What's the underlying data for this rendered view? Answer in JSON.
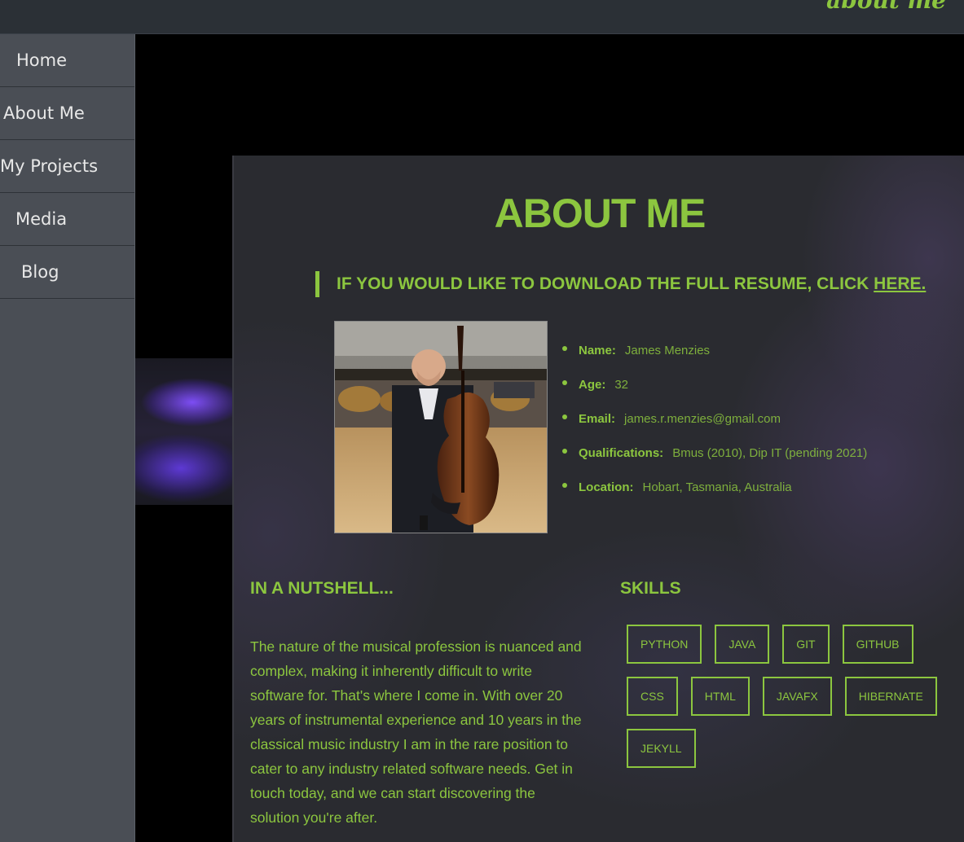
{
  "brand": "about me",
  "sidebar": {
    "items": [
      {
        "label": "Home"
      },
      {
        "label": "About Me"
      },
      {
        "label": "My Projects"
      },
      {
        "label": "Media"
      },
      {
        "label": "Blog"
      }
    ]
  },
  "main": {
    "title": "ABOUT ME",
    "resume_prefix": "IF YOU WOULD LIKE TO DOWNLOAD THE FULL RESUME, CLICK ",
    "resume_link": "HERE.",
    "info": [
      {
        "key": "Name:",
        "value": "James Menzies"
      },
      {
        "key": "Age:",
        "value": "32"
      },
      {
        "key": "Email:",
        "value": "james.r.menzies@gmail.com"
      },
      {
        "key": "Qualifications:",
        "value": "Bmus (2010), Dip IT (pending 2021)"
      },
      {
        "key": "Location:",
        "value": "Hobart, Tasmania, Australia"
      }
    ],
    "nutshell_heading": "IN A NUTSHELL...",
    "nutshell_text": "The nature of the musical profession is nuanced and complex, making it inherently difficult to write software for. That's where I come in. With over 20 years of instrumental experience and 10 years in the classical music industry I am in the rare position to cater to any industry related software needs. Get in touch today, and we can start discovering the solution you're after.",
    "skills_heading": "SKILLS",
    "skills": [
      "PYTHON",
      "JAVA",
      "GIT",
      "GITHUB",
      "CSS",
      "HTML",
      "JAVAFX",
      "HIBERNATE",
      "JEKYLL"
    ]
  },
  "colors": {
    "accent": "#8cc63f",
    "sidebar": "#4a4e55",
    "panel": "#2a2b30"
  }
}
